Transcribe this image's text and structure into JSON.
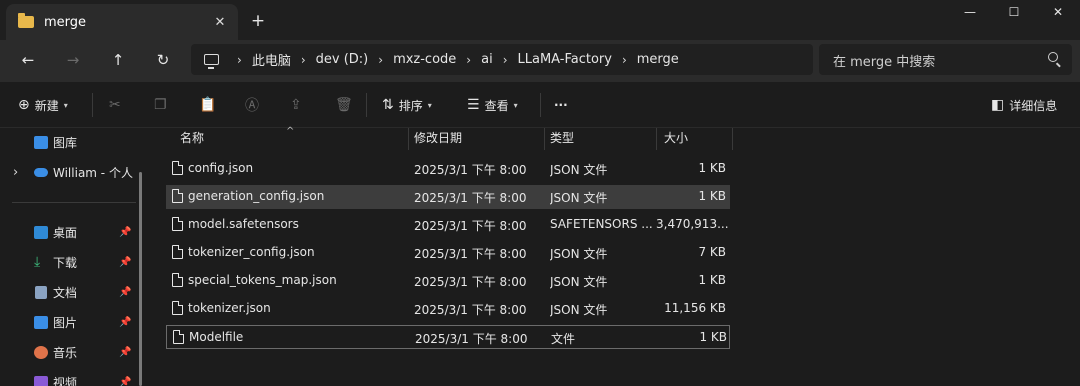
{
  "window": {
    "tab_title": "merge",
    "tab_close": "✕",
    "new_tab": "+",
    "minimize": "—",
    "maximize": "☐",
    "close": "✕"
  },
  "nav": {
    "back": "←",
    "forward": "→",
    "up": "↑",
    "refresh": "↻"
  },
  "address": {
    "icon": "computer-icon",
    "separator": "›",
    "crumbs": [
      "此电脑",
      "dev (D:)",
      "mxz-code",
      "ai",
      "LLaMA-Factory",
      "merge"
    ]
  },
  "search": {
    "placeholder": "在 merge 中搜索"
  },
  "toolbar": {
    "new_label": "新建",
    "sort_label": "排序",
    "view_label": "查看",
    "more_label": "···",
    "details_label": "详细信息"
  },
  "sidebar": {
    "items": [
      {
        "label": "图库",
        "icon": "gallery-icon",
        "color": "#3a8ee6"
      },
      {
        "label": "William - 个人",
        "icon": "onedrive-icon",
        "color": "#3a8ee6"
      },
      {
        "label": "桌面",
        "icon": "desktop-icon",
        "color": "#2f8ad6"
      },
      {
        "label": "下载",
        "icon": "download-icon",
        "color": "#3dbd7d"
      },
      {
        "label": "文档",
        "icon": "documents-icon",
        "color": "#8aa3c2"
      },
      {
        "label": "图片",
        "icon": "pictures-icon",
        "color": "#3a8ee6"
      },
      {
        "label": "音乐",
        "icon": "music-icon",
        "color": "#e0734a"
      },
      {
        "label": "视频",
        "icon": "videos-icon",
        "color": "#8a5ad6"
      }
    ],
    "pin_glyph": "📌",
    "expand_glyph": "›"
  },
  "table": {
    "columns": [
      "名称",
      "修改日期",
      "类型",
      "大小"
    ],
    "rows": [
      {
        "name": "config.json",
        "date": "2025/3/1 下午 8:00",
        "type": "JSON 文件",
        "size": "1 KB"
      },
      {
        "name": "generation_config.json",
        "date": "2025/3/1 下午 8:00",
        "type": "JSON 文件",
        "size": "1 KB"
      },
      {
        "name": "model.safetensors",
        "date": "2025/3/1 下午 8:00",
        "type": "SAFETENSORS ...",
        "size": "3,470,913..."
      },
      {
        "name": "tokenizer_config.json",
        "date": "2025/3/1 下午 8:00",
        "type": "JSON 文件",
        "size": "7 KB"
      },
      {
        "name": "special_tokens_map.json",
        "date": "2025/3/1 下午 8:00",
        "type": "JSON 文件",
        "size": "1 KB"
      },
      {
        "name": "tokenizer.json",
        "date": "2025/3/1 下午 8:00",
        "type": "JSON 文件",
        "size": "11,156 KB"
      },
      {
        "name": "Modelfile",
        "date": "2025/3/1 下午 8:00",
        "type": "文件",
        "size": "1 KB"
      }
    ]
  }
}
